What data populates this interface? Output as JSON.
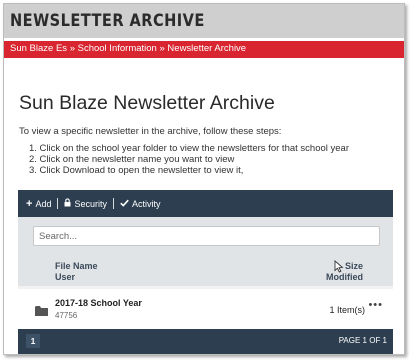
{
  "header": {
    "title": "NEWSLETTER ARCHIVE"
  },
  "breadcrumb": {
    "items": [
      "Sun Blaze Es",
      "School Information",
      "Newsletter Archive"
    ],
    "separator": "»"
  },
  "main": {
    "page_title": "Sun Blaze Newsletter Archive",
    "intro": "To view a specific newsletter in the archive, follow these steps:",
    "steps": [
      "1. Click on the school year folder to view the newsletters for that school year",
      "2. Click on the newsletter name you want to view",
      "3. Click Download to open the newsletter to view it,"
    ]
  },
  "toolbar": {
    "add_label": "Add",
    "security_label": "Security",
    "activity_label": "Activity"
  },
  "search": {
    "placeholder": "Search..."
  },
  "columns": {
    "name": "File Name",
    "user": "User",
    "size": "Size",
    "modified": "Modified"
  },
  "rows": [
    {
      "name": "2017-18 School Year",
      "user": "47756",
      "size": "1 Item(s)",
      "icon": "folder-icon"
    }
  ],
  "pagination": {
    "current": "1",
    "info": "PAGE 1 OF 1"
  },
  "colors": {
    "header_band": "#cfcfcf",
    "breadcrumb_band": "#d8252f",
    "panel": "#2c3e50"
  }
}
